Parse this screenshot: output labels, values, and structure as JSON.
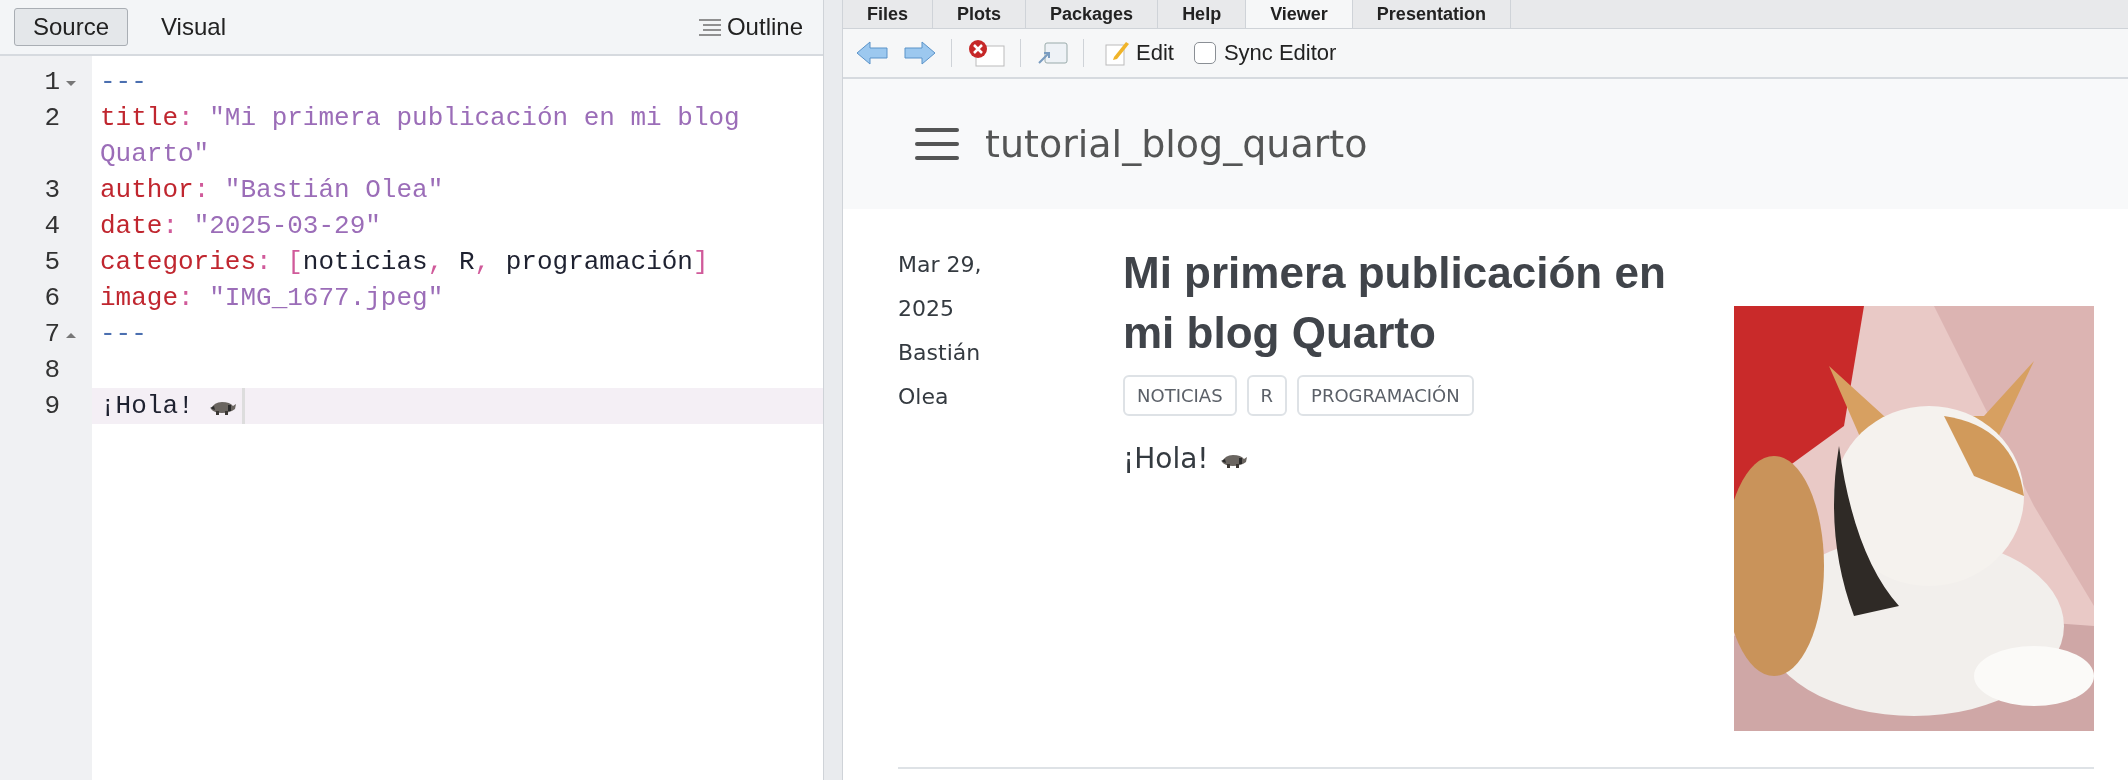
{
  "editor": {
    "modes": [
      {
        "label": "Source",
        "selected": true
      },
      {
        "label": "Visual",
        "selected": false
      }
    ],
    "outline": "Outline",
    "lines": [
      {
        "number": "1",
        "fold_start": true,
        "active": false,
        "tokens": [
          {
            "kind": "dash",
            "text": "---"
          }
        ]
      },
      {
        "number": "2",
        "active": false,
        "tokens": [
          {
            "kind": "key",
            "text": "title"
          },
          {
            "kind": "punct",
            "text": ": "
          },
          {
            "kind": "string",
            "text": "\"Mi primera publicación en mi blog Quarto\""
          }
        ]
      },
      {
        "number": "3",
        "active": false,
        "tokens": [
          {
            "kind": "key",
            "text": "author"
          },
          {
            "kind": "punct",
            "text": ": "
          },
          {
            "kind": "string",
            "text": "\"Bastián Olea\""
          }
        ]
      },
      {
        "number": "4",
        "active": false,
        "tokens": [
          {
            "kind": "key",
            "text": "date"
          },
          {
            "kind": "punct",
            "text": ": "
          },
          {
            "kind": "string",
            "text": "\"2025-03-29\""
          }
        ]
      },
      {
        "number": "5",
        "active": false,
        "tokens": [
          {
            "kind": "key",
            "text": "categories"
          },
          {
            "kind": "punct",
            "text": ": "
          },
          {
            "kind": "punct",
            "text": "["
          },
          {
            "kind": "plain",
            "text": "noticias"
          },
          {
            "kind": "punct",
            "text": ", "
          },
          {
            "kind": "plain",
            "text": "R"
          },
          {
            "kind": "punct",
            "text": ", "
          },
          {
            "kind": "plain",
            "text": "programación"
          },
          {
            "kind": "punct",
            "text": "]"
          }
        ]
      },
      {
        "number": "6",
        "active": false,
        "tokens": [
          {
            "kind": "key",
            "text": "image"
          },
          {
            "kind": "punct",
            "text": ": "
          },
          {
            "kind": "string",
            "text": "\"IMG_1677.jpeg\""
          }
        ]
      },
      {
        "number": "7",
        "fold_end": true,
        "active": false,
        "tokens": [
          {
            "kind": "dash",
            "text": "---"
          }
        ]
      },
      {
        "number": "8",
        "active": false
      },
      {
        "number": "9",
        "active": true,
        "tokens": [
          {
            "kind": "plain",
            "text": "¡Hola!"
          },
          {
            "kind": "emoji"
          }
        ]
      }
    ]
  },
  "viewer": {
    "tabs": [
      {
        "label": "Files",
        "selected": false
      },
      {
        "label": "Plots",
        "selected": false
      },
      {
        "label": "Packages",
        "selected": false
      },
      {
        "label": "Help",
        "selected": false
      },
      {
        "label": "Viewer",
        "selected": true
      },
      {
        "label": "Presentation",
        "selected": false
      }
    ],
    "toolbar": {
      "edit": "Edit",
      "sync": {
        "label": "Sync Editor",
        "checked": false
      }
    },
    "site": {
      "brand": "tutorial_blog_quarto",
      "post": {
        "date": [
          "Mar 29,",
          "2025"
        ],
        "author": [
          "Bastián",
          "Olea"
        ],
        "title": "Mi primera publicación en mi blog Quarto",
        "categories": [
          "NOTICIAS",
          "R",
          "PROGRAMACIÓN"
        ],
        "body": "¡Hola!",
        "image": {
          "kind": "picture"
        }
      }
    }
  }
}
